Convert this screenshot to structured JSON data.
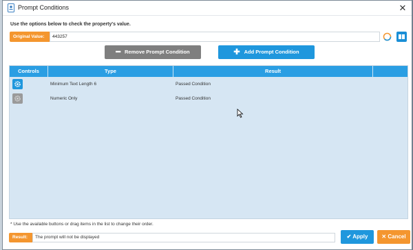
{
  "window": {
    "title": "Prompt Conditions",
    "close_icon": "close-icon"
  },
  "instructions": "Use the options below to check the property's value.",
  "original_value": {
    "label": "Original Value:",
    "value": "443257"
  },
  "buttons": {
    "remove": "Remove Prompt Condition",
    "add": "Add Prompt Condition",
    "apply": "Apply",
    "cancel": "Cancel"
  },
  "grid": {
    "columns": [
      "Controls",
      "Type",
      "Result",
      ""
    ],
    "rows": [
      {
        "type": "Minimum Text Length 6",
        "result": "Passed Condition",
        "control": "gear-icon",
        "active": true
      },
      {
        "type": "Numeric Only",
        "result": "Passed Condition",
        "control": "gear-icon",
        "active": false
      }
    ]
  },
  "footnote": "* Use the available buttons or drag items in the list to change their order.",
  "result": {
    "label": "Result:",
    "value": "The prompt will not be displayed"
  },
  "colors": {
    "accent_blue": "#1f97dd",
    "accent_orange": "#f4962f",
    "grid_bg": "#d6e6f3",
    "disabled_gray": "#7f7f7f"
  }
}
